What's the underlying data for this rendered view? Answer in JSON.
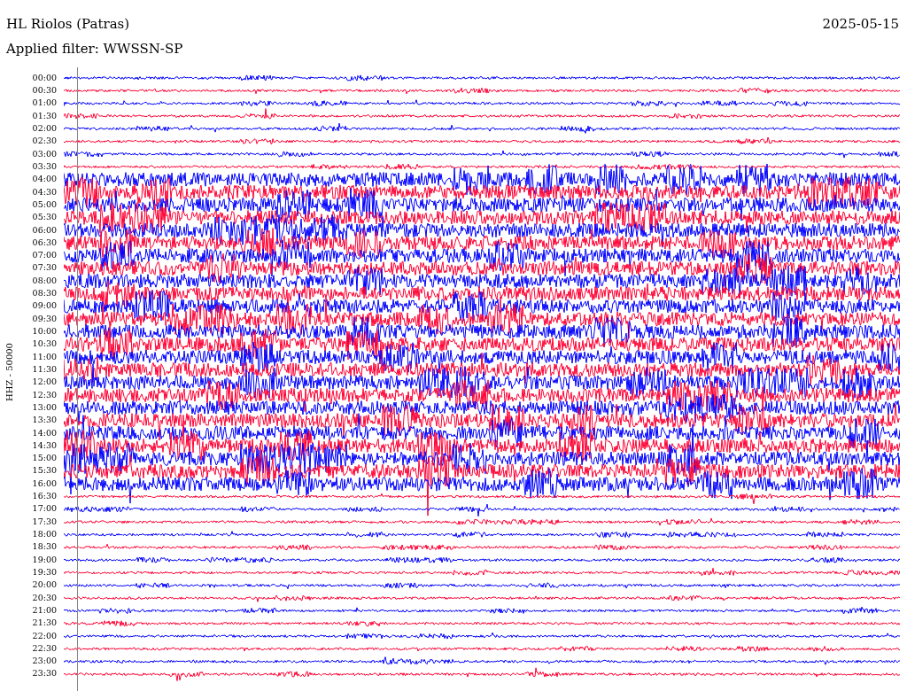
{
  "header": {
    "station": "HL Riolos (Patras)",
    "date": "2025-05-15",
    "filter": "Applied filter: WWSSN-SP"
  },
  "y_axis_label": "HHZ - 50000",
  "rows": [
    {
      "label": "00:00",
      "color": "#0000ff",
      "kind": "quiet"
    },
    {
      "label": "00:30",
      "color": "#ff0033",
      "kind": "quiet"
    },
    {
      "label": "01:00",
      "color": "#0000ff",
      "kind": "quiet"
    },
    {
      "label": "01:30",
      "color": "#ff0033",
      "kind": "quiet"
    },
    {
      "label": "02:00",
      "color": "#0000ff",
      "kind": "quiet"
    },
    {
      "label": "02:30",
      "color": "#ff0033",
      "kind": "quiet"
    },
    {
      "label": "03:00",
      "color": "#0000ff",
      "kind": "quiet"
    },
    {
      "label": "03:30",
      "color": "#ff0033",
      "kind": "quiet"
    },
    {
      "label": "04:00",
      "color": "#0000ff",
      "kind": "noisy"
    },
    {
      "label": "04:30",
      "color": "#ff0033",
      "kind": "noisy"
    },
    {
      "label": "05:00",
      "color": "#0000ff",
      "kind": "noisy"
    },
    {
      "label": "05:30",
      "color": "#ff0033",
      "kind": "noisy"
    },
    {
      "label": "06:00",
      "color": "#0000ff",
      "kind": "noisy"
    },
    {
      "label": "06:30",
      "color": "#ff0033",
      "kind": "noisy"
    },
    {
      "label": "07:00",
      "color": "#0000ff",
      "kind": "noisy"
    },
    {
      "label": "07:30",
      "color": "#ff0033",
      "kind": "noisy"
    },
    {
      "label": "08:00",
      "color": "#0000ff",
      "kind": "noisy"
    },
    {
      "label": "08:30",
      "color": "#ff0033",
      "kind": "noisy"
    },
    {
      "label": "09:00",
      "color": "#0000ff",
      "kind": "noisy"
    },
    {
      "label": "09:30",
      "color": "#ff0033",
      "kind": "noisy"
    },
    {
      "label": "10:00",
      "color": "#0000ff",
      "kind": "noisy"
    },
    {
      "label": "10:30",
      "color": "#ff0033",
      "kind": "noisy"
    },
    {
      "label": "11:00",
      "color": "#0000ff",
      "kind": "noisy"
    },
    {
      "label": "11:30",
      "color": "#ff0033",
      "kind": "noisy"
    },
    {
      "label": "12:00",
      "color": "#0000ff",
      "kind": "noisy"
    },
    {
      "label": "12:30",
      "color": "#ff0033",
      "kind": "noisy"
    },
    {
      "label": "13:00",
      "color": "#0000ff",
      "kind": "noisy"
    },
    {
      "label": "13:30",
      "color": "#ff0033",
      "kind": "noisy"
    },
    {
      "label": "14:00",
      "color": "#0000ff",
      "kind": "noisy"
    },
    {
      "label": "14:30",
      "color": "#ff0033",
      "kind": "noisy"
    },
    {
      "label": "15:00",
      "color": "#0000ff",
      "kind": "noisy"
    },
    {
      "label": "15:30",
      "color": "#ff0033",
      "kind": "noisy"
    },
    {
      "label": "16:00",
      "color": "#0000ff",
      "kind": "noisy"
    },
    {
      "label": "16:30",
      "color": "#ff0033",
      "kind": "quiet"
    },
    {
      "label": "17:00",
      "color": "#0000ff",
      "kind": "quiet"
    },
    {
      "label": "17:30",
      "color": "#ff0033",
      "kind": "quiet"
    },
    {
      "label": "18:00",
      "color": "#0000ff",
      "kind": "quiet"
    },
    {
      "label": "18:30",
      "color": "#ff0033",
      "kind": "quiet"
    },
    {
      "label": "19:00",
      "color": "#0000ff",
      "kind": "quiet"
    },
    {
      "label": "19:30",
      "color": "#ff0033",
      "kind": "quiet"
    },
    {
      "label": "20:00",
      "color": "#0000ff",
      "kind": "quiet"
    },
    {
      "label": "20:30",
      "color": "#ff0033",
      "kind": "quiet"
    },
    {
      "label": "21:00",
      "color": "#0000ff",
      "kind": "quiet"
    },
    {
      "label": "21:30",
      "color": "#ff0033",
      "kind": "quiet"
    },
    {
      "label": "22:00",
      "color": "#0000ff",
      "kind": "quiet"
    },
    {
      "label": "22:30",
      "color": "#ff0033",
      "kind": "quiet"
    },
    {
      "label": "23:00",
      "color": "#0000ff",
      "kind": "quiet"
    },
    {
      "label": "23:30",
      "color": "#ff0033",
      "kind": "quiet"
    }
  ]
}
